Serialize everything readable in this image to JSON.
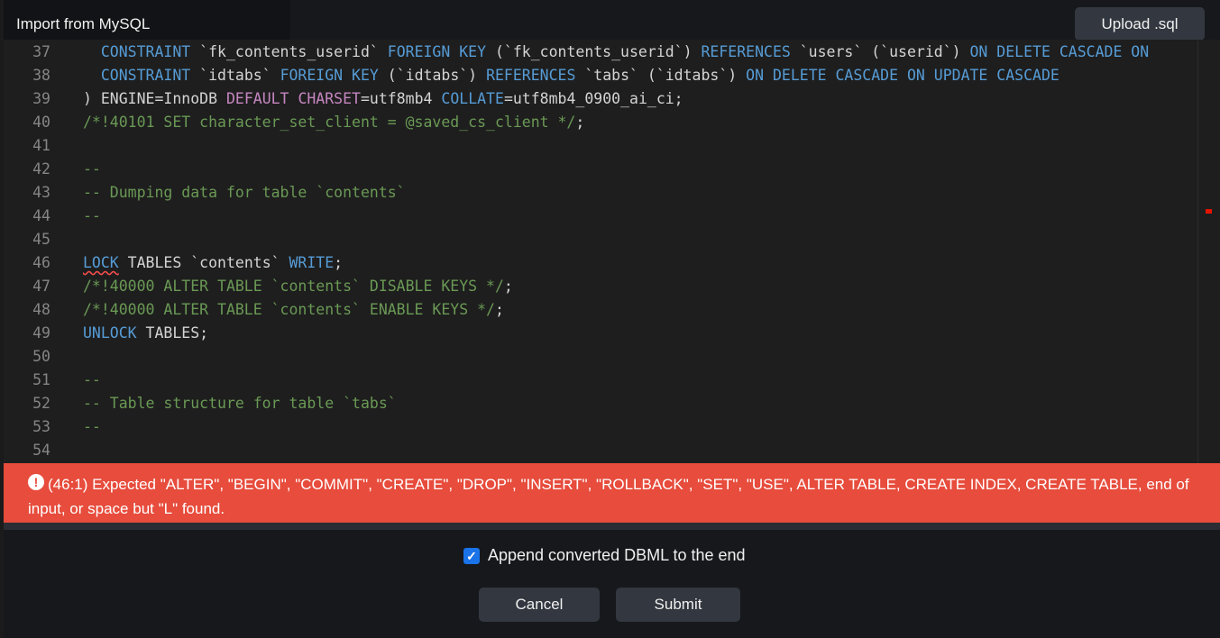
{
  "modal": {
    "title": "Import from MySQL",
    "upload_label": "Upload .sql"
  },
  "editor": {
    "lines": [
      {
        "no": "37",
        "segments": [
          {
            "t": "  ",
            "c": "txt"
          },
          {
            "t": "CONSTRAINT",
            "c": "kw"
          },
          {
            "t": " `fk_contents_userid` ",
            "c": "txt"
          },
          {
            "t": "FOREIGN KEY",
            "c": "kw"
          },
          {
            "t": " (`fk_contents_userid`) ",
            "c": "txt"
          },
          {
            "t": "REFERENCES",
            "c": "kw"
          },
          {
            "t": " `users` (`userid`) ",
            "c": "txt"
          },
          {
            "t": "ON DELETE CASCADE ON",
            "c": "kw"
          }
        ]
      },
      {
        "no": "38",
        "segments": [
          {
            "t": "  ",
            "c": "txt"
          },
          {
            "t": "CONSTRAINT",
            "c": "kw"
          },
          {
            "t": " `idtabs` ",
            "c": "txt"
          },
          {
            "t": "FOREIGN KEY",
            "c": "kw"
          },
          {
            "t": " (`idtabs`) ",
            "c": "txt"
          },
          {
            "t": "REFERENCES",
            "c": "kw"
          },
          {
            "t": " `tabs` (`idtabs`) ",
            "c": "txt"
          },
          {
            "t": "ON DELETE CASCADE ON UPDATE CASCADE",
            "c": "kw"
          }
        ]
      },
      {
        "no": "39",
        "segments": [
          {
            "t": ") ENGINE=InnoDB ",
            "c": "txt"
          },
          {
            "t": "DEFAULT",
            "c": "pk"
          },
          {
            "t": " ",
            "c": "txt"
          },
          {
            "t": "CHARSET",
            "c": "pk"
          },
          {
            "t": "=utf8mb4 ",
            "c": "txt"
          },
          {
            "t": "COLLATE",
            "c": "kw"
          },
          {
            "t": "=utf8mb4_0900_ai_ci;",
            "c": "txt"
          }
        ]
      },
      {
        "no": "40",
        "segments": [
          {
            "t": "/*!40101 SET character_set_client = @saved_cs_client */",
            "c": "cm"
          },
          {
            "t": ";",
            "c": "txt"
          }
        ]
      },
      {
        "no": "41",
        "segments": []
      },
      {
        "no": "42",
        "segments": [
          {
            "t": "--",
            "c": "cm"
          }
        ]
      },
      {
        "no": "43",
        "segments": [
          {
            "t": "-- Dumping data for table `contents`",
            "c": "cm"
          }
        ]
      },
      {
        "no": "44",
        "segments": [
          {
            "t": "--",
            "c": "cm"
          }
        ]
      },
      {
        "no": "45",
        "segments": []
      },
      {
        "no": "46",
        "segments": [
          {
            "t": "LOCK",
            "c": "kw sq"
          },
          {
            "t": " TABLES `contents` ",
            "c": "txt"
          },
          {
            "t": "WRITE",
            "c": "kw"
          },
          {
            "t": ";",
            "c": "txt"
          }
        ]
      },
      {
        "no": "47",
        "segments": [
          {
            "t": "/*!40000 ALTER TABLE `contents` DISABLE KEYS */",
            "c": "cm"
          },
          {
            "t": ";",
            "c": "txt"
          }
        ]
      },
      {
        "no": "48",
        "segments": [
          {
            "t": "/*!40000 ALTER TABLE `contents` ENABLE KEYS */",
            "c": "cm"
          },
          {
            "t": ";",
            "c": "txt"
          }
        ]
      },
      {
        "no": "49",
        "segments": [
          {
            "t": "UNLOCK",
            "c": "kw"
          },
          {
            "t": " TABLES;",
            "c": "txt"
          }
        ]
      },
      {
        "no": "50",
        "segments": []
      },
      {
        "no": "51",
        "segments": [
          {
            "t": "--",
            "c": "cm"
          }
        ]
      },
      {
        "no": "52",
        "segments": [
          {
            "t": "-- Table structure for table `tabs`",
            "c": "cm"
          }
        ]
      },
      {
        "no": "53",
        "segments": [
          {
            "t": "--",
            "c": "cm"
          }
        ]
      },
      {
        "no": "54",
        "segments": []
      }
    ]
  },
  "error": {
    "icon": "exclamation-circle-icon",
    "message": "(46:1) Expected \"ALTER\", \"BEGIN\", \"COMMIT\", \"CREATE\", \"DROP\", \"INSERT\", \"ROLLBACK\", \"SET\", \"USE\", ALTER TABLE, CREATE INDEX, CREATE TABLE, end of input, or space but \"L\" found."
  },
  "options": {
    "append_label": "Append converted DBML to the end",
    "append_checked": true
  },
  "footer": {
    "cancel_label": "Cancel",
    "submit_label": "Submit"
  },
  "colors": {
    "error_bg": "#e74c3c",
    "keyword": "#569cd6",
    "keyword_purple": "#c586c0",
    "comment": "#6a9955"
  }
}
